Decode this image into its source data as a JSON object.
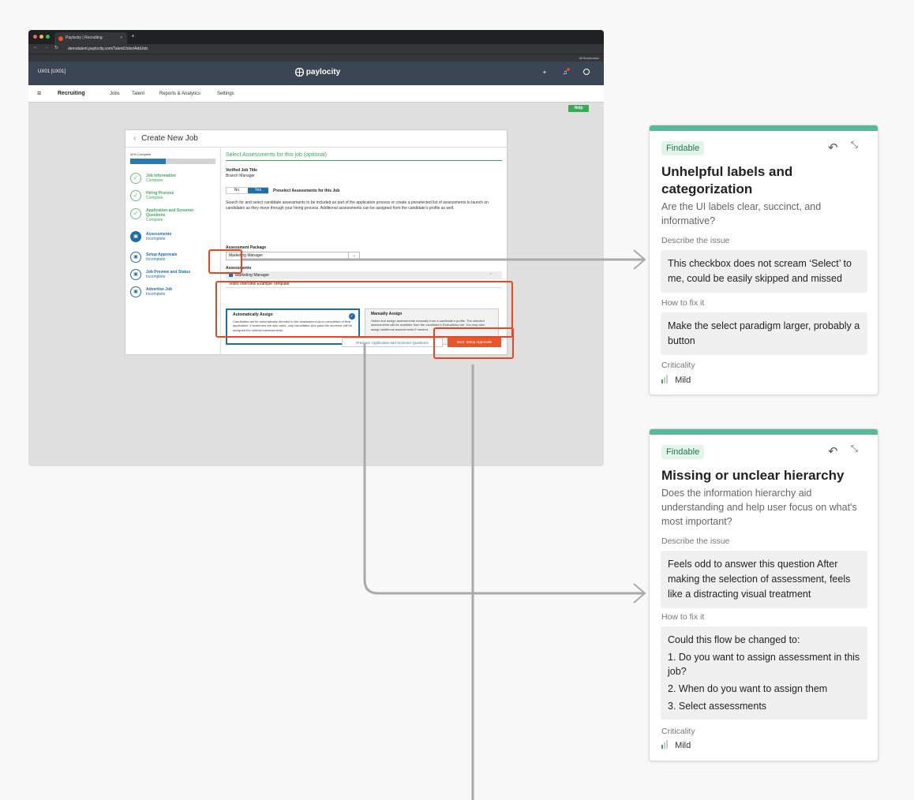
{
  "browser": {
    "tab_title": "Paylocity | Recruiting",
    "url": "demotalent.paylocity.com/Talent/Jobs/AddJob",
    "all_bookmarks": "All Bookmarks"
  },
  "app": {
    "env_label": "UX01 [UX01]",
    "logo": "paylocity",
    "help": "Help",
    "nav": {
      "menu": "≡",
      "module": "Recruiting",
      "items": [
        "Jobs",
        "Talent",
        "Reports & Analytics",
        "Settings"
      ]
    }
  },
  "job_form": {
    "title": "Create New Job",
    "progress_label": "42% Complete",
    "progress": 0.42,
    "steps": [
      {
        "title": "Job Information",
        "status": "Complete"
      },
      {
        "title": "Hiring Process",
        "status": "Complete"
      },
      {
        "title": "Application and Screener Questions",
        "status": "Complete"
      },
      {
        "title": "Assessments",
        "status": "Incomplete"
      },
      {
        "title": "Setup Approvals",
        "status": "Incomplete"
      },
      {
        "title": "Job Preview and Status",
        "status": "Incomplete"
      },
      {
        "title": "Advertise Job",
        "status": "Incomplete"
      }
    ],
    "section_title": "Select Assessments for this job (optional)",
    "verified_label": "Verified Job Title",
    "verified_value": "Branch Manager",
    "toggle_no": "No",
    "toggle_yes": "Yes",
    "preselect_label": "Preselect Assessments for this Job",
    "description": "Search for and select candidate assessments to be included as part of the application process or create a preselected list of assessments to launch on candidates as they move through your hiring process. Additional assessments can be assigned from the candidate's profile as well.",
    "package_label": "Assessment Package",
    "package_value": "Marketing Manager",
    "assessments_label": "Assessments",
    "assessment_item": "Marketing Manager",
    "video_item": "Video Interview Example Template",
    "auto_title": "Automatically Assign",
    "auto_desc": "Candidates will be automatically directed to the assessment upon completion of their application. If screeners are also used, only candidates who pass the screener will be assigned the selected assessments.",
    "manual_title": "Manually Assign",
    "manual_desc": "Select and assign assessments manually from a candidate's profile. The selected assessments will be available from the candidate's Evaluations tab. You may also assign additional assessments if needed.",
    "btn_prev": "Previous: Application and Screener Questions",
    "btn_next": "Next: Setup Approvals"
  },
  "cards": [
    {
      "badge": "Findable",
      "title": "Unhelpful labels and categorization",
      "question": "Are the UI labels clear, succinct, and informative?",
      "describe_label": "Describe the issue",
      "describe": "This checkbox does not scream ‘Select’ to me, could be easily skipped and missed",
      "fix_label": "How to fix it",
      "fix": [
        "Make the select paradigm larger, probably a button"
      ],
      "criticality_label": "Criticality",
      "criticality": "Mild"
    },
    {
      "badge": "Findable",
      "title": "Missing or unclear hierarchy",
      "question": "Does the information hierarchy aid understanding and help user focus on what's most important?",
      "describe_label": "Describe the issue",
      "describe": "Feels odd to answer this question After making the selection of assessment, feels like a distracting visual treatment",
      "fix_label": "How to fix it",
      "fix": [
        "Could this flow be changed to:",
        "1. Do you want to assign assessment in this job?",
        "2. When do you want to assign them",
        "3. Select assessments"
      ],
      "criticality_label": "Criticality",
      "criticality": "Mild"
    }
  ],
  "colors": {
    "accent": "#5bb89a",
    "highlight": "#e8481f",
    "brand_blue": "#1d6fa5",
    "complete_green": "#3aaa57"
  }
}
